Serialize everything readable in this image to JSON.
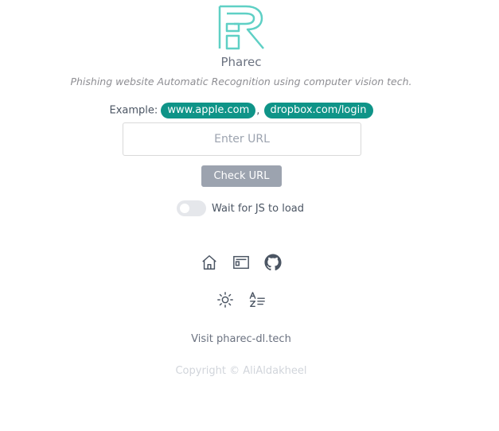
{
  "app": {
    "name": "Pharec",
    "tagline": "Phishing website Automatic Recognition using computer vision tech."
  },
  "examples": {
    "label": "Example:",
    "items": [
      "www.apple.com",
      "dropbox.com/login"
    ],
    "separator": ","
  },
  "url_input": {
    "value": "",
    "placeholder": "Enter URL"
  },
  "check_button": {
    "label": "Check URL"
  },
  "js_toggle": {
    "label": "Wait for JS to load",
    "enabled": false
  },
  "nav_icons": [
    "home-icon",
    "newspaper-icon",
    "github-icon"
  ],
  "setting_icons": [
    "sun-icon",
    "translate-icon"
  ],
  "visit_link": "Visit pharec-dl.tech",
  "copyright": "Copyright © AliAldakheel",
  "colors": {
    "accent": "#0f9488",
    "logo": "#5fd0c5",
    "button": "#9ca3af",
    "icon": "#4b5563"
  }
}
